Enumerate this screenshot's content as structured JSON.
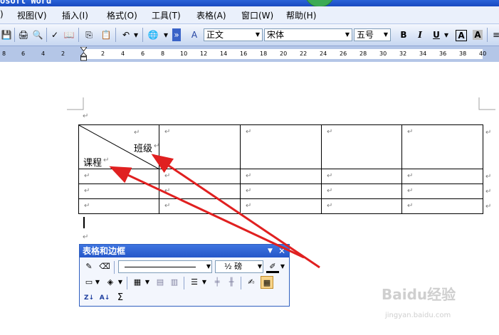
{
  "app": {
    "title_fragment": "osoft Word"
  },
  "menu": [
    "视图(V)",
    "插入(I)",
    "格式(O)",
    "工具(T)",
    "表格(A)",
    "窗口(W)",
    "帮助(H)"
  ],
  "menu_prefix": ")",
  "formatting": {
    "style": "正文",
    "font": "宋体",
    "size": "五号",
    "bold": "B",
    "italic": "I",
    "underline": "U",
    "char_border": "A",
    "char_shading": "A"
  },
  "ruler": {
    "numbers": [
      "8",
      "6",
      "4",
      "2",
      "2",
      "4",
      "6",
      "8",
      "10",
      "12",
      "14",
      "16",
      "18",
      "20",
      "22",
      "24",
      "26",
      "28",
      "30",
      "32",
      "34",
      "36",
      "38",
      "40"
    ]
  },
  "document": {
    "para_mark": "↵",
    "table": {
      "header_top_label": "班级",
      "header_bottom_label": "课程",
      "rows": 4,
      "cols": 5
    }
  },
  "float_toolbar": {
    "title": "表格和边框",
    "line_weight": "½ 磅",
    "sum_symbol": "Σ",
    "sort_asc_label": "A↓",
    "sort_desc_label": "Z↓"
  },
  "watermark": {
    "text": "Baidu经验",
    "url_text": "jingyan.baidu.com"
  },
  "colors": {
    "annotation_arrow": "#e02020",
    "toolbar_blue": "#2557c9"
  }
}
